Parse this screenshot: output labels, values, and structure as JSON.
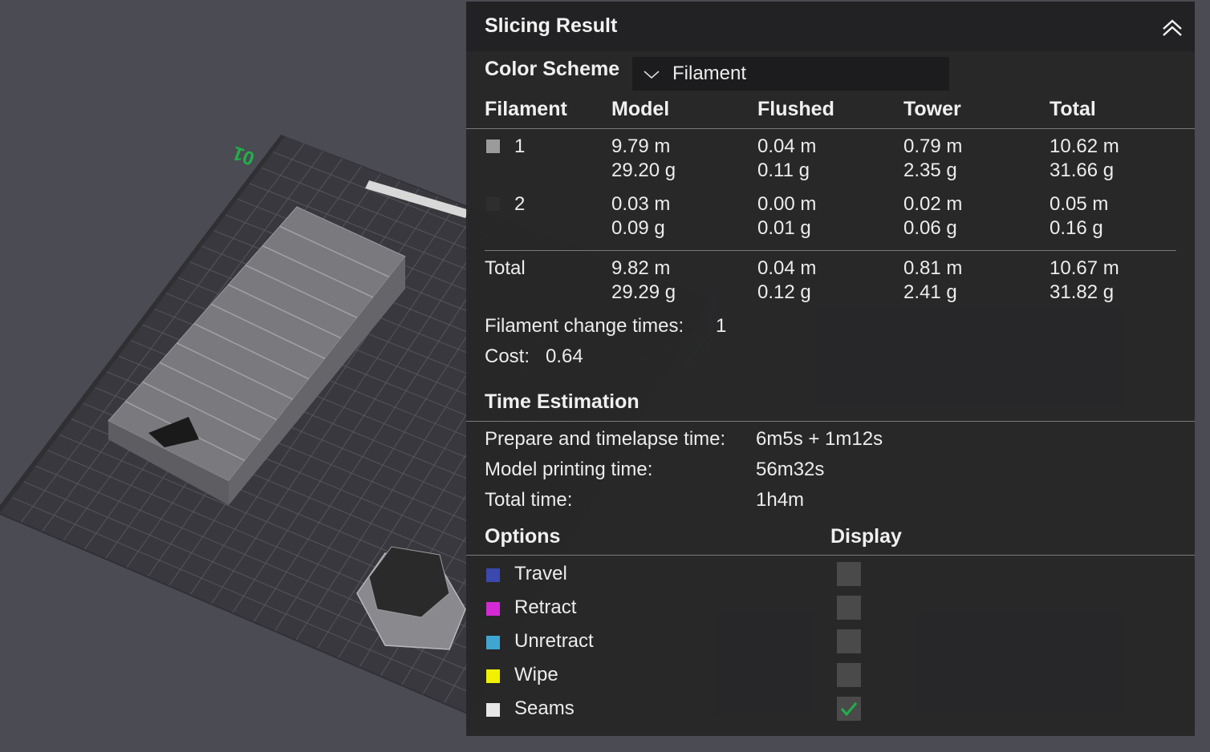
{
  "panel": {
    "title": "Slicing Result",
    "color_scheme_label": "Color Scheme",
    "color_scheme_value": "Filament"
  },
  "filament_table": {
    "headers": [
      "Filament",
      "Model",
      "Flushed",
      "Tower",
      "Total"
    ],
    "rows": [
      {
        "id": "1",
        "swatch": "#9b9b9b",
        "model": [
          "9.79 m",
          "29.20 g"
        ],
        "flushed": [
          "0.04 m",
          "0.11 g"
        ],
        "tower": [
          "0.79 m",
          "2.35 g"
        ],
        "total": [
          "10.62 m",
          "31.66 g"
        ]
      },
      {
        "id": "2",
        "swatch": "#2e2e2e",
        "model": [
          "0.03 m",
          "0.09 g"
        ],
        "flushed": [
          "0.00 m",
          "0.01 g"
        ],
        "tower": [
          "0.02 m",
          "0.06 g"
        ],
        "total": [
          "0.05 m",
          "0.16 g"
        ]
      }
    ],
    "total_row": {
      "label": "Total",
      "model": [
        "9.82 m",
        "29.29 g"
      ],
      "flushed": [
        "0.04 m",
        "0.12 g"
      ],
      "tower": [
        "0.81 m",
        "2.41 g"
      ],
      "total": [
        "10.67 m",
        "31.82 g"
      ]
    }
  },
  "summary": {
    "filament_change_label": "Filament change times:",
    "filament_change_value": "1",
    "cost_label": "Cost:",
    "cost_value": "0.64"
  },
  "time_estimation": {
    "title": "Time Estimation",
    "rows": [
      {
        "label": "Prepare and timelapse time:",
        "value": "6m5s + 1m12s"
      },
      {
        "label": "Model printing time:",
        "value": "56m32s"
      },
      {
        "label": "Total time:",
        "value": "1h4m"
      }
    ]
  },
  "options": {
    "header": "Options",
    "display_header": "Display",
    "items": [
      {
        "label": "Travel",
        "color": "#3b48b0",
        "checked": false
      },
      {
        "label": "Retract",
        "color": "#d42ad6",
        "checked": false
      },
      {
        "label": "Unretract",
        "color": "#3ea6d0",
        "checked": false
      },
      {
        "label": "Wipe",
        "color": "#f2f200",
        "checked": false
      },
      {
        "label": "Seams",
        "color": "#e8e8e8",
        "checked": true
      }
    ]
  },
  "viewport": {
    "plate_number": "01",
    "icons": [
      "build-plate",
      "model-box",
      "small-prime-tower",
      "axis-gizmo"
    ]
  },
  "colors": {
    "panel_bg": "#262628",
    "header_bg": "#222224",
    "check_accent": "#1fb04a",
    "plate_number_color": "#22b04a"
  }
}
